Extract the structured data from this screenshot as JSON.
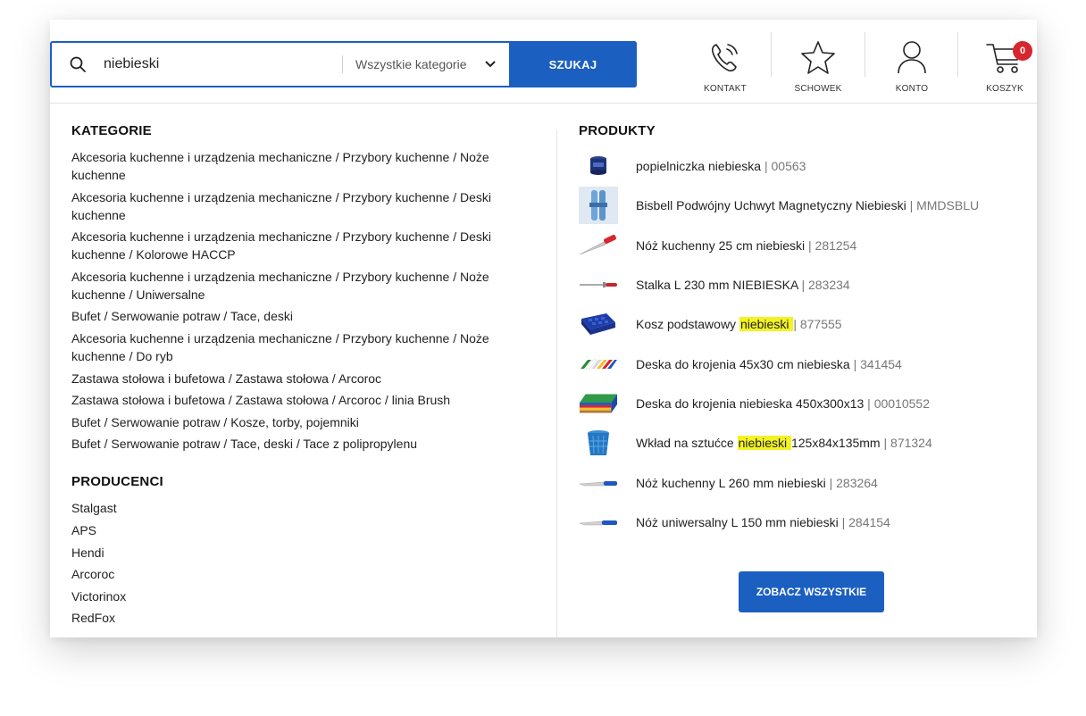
{
  "search": {
    "query": "niebieski",
    "category": "Wszystkie kategorie",
    "button": "SZUKAJ"
  },
  "header": {
    "contact": "KONTAKT",
    "wishlist": "SCHOWEK",
    "account": "KONTO",
    "cart": "KOSZYK",
    "cart_count": "0"
  },
  "categories": {
    "heading": "KATEGORIE",
    "items": [
      "Akcesoria kuchenne i urządzenia mechaniczne / Przybory kuchenne / Noże kuchenne",
      "Akcesoria kuchenne i urządzenia mechaniczne / Przybory kuchenne / Deski kuchenne",
      "Akcesoria kuchenne i urządzenia mechaniczne / Przybory kuchenne / Deski kuchenne / Kolorowe HACCP",
      "Akcesoria kuchenne i urządzenia mechaniczne / Przybory kuchenne / Noże kuchenne / Uniwersalne",
      "Bufet / Serwowanie potraw / Tace, deski",
      "Akcesoria kuchenne i urządzenia mechaniczne / Przybory kuchenne / Noże kuchenne / Do ryb",
      "Zastawa stołowa i bufetowa / Zastawa stołowa / Arcoroc",
      "Zastawa stołowa i bufetowa / Zastawa stołowa / Arcoroc / linia Brush",
      "Bufet / Serwowanie potraw / Kosze, torby, pojemniki",
      "Bufet / Serwowanie potraw / Tace, deski / Tace z polipropylenu"
    ]
  },
  "producers": {
    "heading": "PRODUCENCI",
    "items": [
      "Stalgast",
      "APS",
      "Hendi",
      "Arcoroc",
      "Victorinox",
      "RedFox"
    ]
  },
  "products": {
    "heading": "PRODUKTY",
    "items": [
      {
        "pre": "popielniczka niebieska",
        "hl": "",
        "post": "",
        "code": "00563",
        "icon": "ashtray-icon"
      },
      {
        "pre": "Bisbell Podwójny Uchwyt Magnetyczny Niebieski",
        "hl": "",
        "post": "",
        "code": "MMDSBLU",
        "icon": "magnetic-holder-icon"
      },
      {
        "pre": "Nóż kuchenny 25 cm niebieski",
        "hl": "",
        "post": "",
        "code": "281254",
        "icon": "knife-icon"
      },
      {
        "pre": "Stalka L 230 mm NIEBIESKA",
        "hl": "",
        "post": "",
        "code": "283234",
        "icon": "sharpening-steel-icon"
      },
      {
        "pre": "Kosz podstawowy ",
        "hl": "niebieski ",
        "post": "",
        "code": "877555",
        "icon": "basket-icon"
      },
      {
        "pre": "Deska do krojenia 45x30 cm niebieska",
        "hl": "",
        "post": "",
        "code": "341454",
        "icon": "cutting-boards-icon"
      },
      {
        "pre": "Deska do krojenia niebieska 450x300x13",
        "hl": "",
        "post": "",
        "code": "00010552",
        "icon": "cutting-board-stack-icon"
      },
      {
        "pre": "Wkład na sztućce ",
        "hl": "niebieski ",
        "post": "125x84x135mm",
        "code": "871324",
        "icon": "cutlery-holder-icon"
      },
      {
        "pre": "Nóż kuchenny L 260 mm niebieski",
        "hl": "",
        "post": "",
        "code": "283264",
        "icon": "knife-icon"
      },
      {
        "pre": "Nóż uniwersalny L 150 mm niebieski",
        "hl": "",
        "post": "",
        "code": "284154",
        "icon": "knife-icon"
      }
    ],
    "see_all": "ZOBACZ WSZYSTKIE"
  },
  "colors": {
    "accent": "#1b5fc1",
    "badge": "#d7262e",
    "highlight": "#f3f324"
  }
}
